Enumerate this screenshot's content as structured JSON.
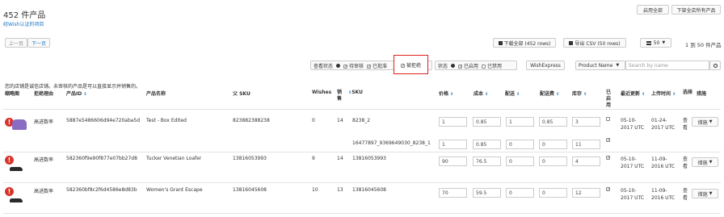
{
  "header": {
    "title": "452 件产品",
    "subtitle": "经Wish认证的项目",
    "enable_all": "启用全部",
    "delist_all": "下架全店所有产品"
  },
  "pager": {
    "prev": "上一页",
    "next": "下一页",
    "range": "1 到 50 件产品",
    "page_size": "50"
  },
  "downloads": {
    "all": "下载全部 (452 rows)",
    "csv": "导出 CSV (50 rows)"
  },
  "filters": {
    "review_label": "查看状态",
    "pending": "待审核",
    "approved": "已批准",
    "rejected": "被拒绝",
    "state_label": "状态",
    "enabled": "已启用",
    "disabled": "已禁用",
    "wishexpress": "WishExpress",
    "search_field": "Product Name",
    "search_placeholder": "Search by name"
  },
  "notice": "您的店铺是诚信店铺。未审核的产品是可以直接显示并销售的。",
  "columns": {
    "thumb": "缩略图",
    "reason": "拒绝理由",
    "product_id": "产品ID",
    "name": "产品名称",
    "parent_sku": "父 SKU",
    "wishes": "Wishes",
    "sales": "销售",
    "sku": "SKU",
    "price": "价格",
    "cost": "成本",
    "shipping": "配送",
    "shipping_fee": "配送费",
    "inventory": "库存",
    "enabled": "已启用",
    "updated": "最近更新",
    "upload_time": "上传时间",
    "select": "选择",
    "actions": "措施"
  },
  "rows": [
    {
      "reason": "高进数率",
      "product_id": "5887e5486606d94e720aba5d",
      "name": "Test - Box Edited",
      "parent_sku": "823882388238",
      "wishes": "0",
      "sales": "14",
      "updated": "05-10-2017 UTC",
      "upload": "01-24-2017 UTC",
      "view": "查看",
      "action": "措施",
      "variants": [
        {
          "sku": "8238_2",
          "price": "1",
          "cost": "0.85",
          "ship": "1",
          "fee": "0.85",
          "inv": "3",
          "enabled": false
        },
        {
          "sku": "16477897_9369649030_8238_1",
          "price": "1",
          "cost": "0.85",
          "ship": "0",
          "fee": "0",
          "inv": "11",
          "enabled": true
        }
      ]
    },
    {
      "reason": "高进数率",
      "product_id": "582360f9e90f877e07bb27d8",
      "name": "Tucker Venetian Loafer",
      "parent_sku": "13816053993",
      "wishes": "9",
      "sales": "14",
      "updated": "05-10-2017 UTC",
      "upload": "11-09-2016 UTC",
      "view": "查看",
      "action": "措施",
      "variants": [
        {
          "sku": "13816053993",
          "price": "90",
          "cost": "76.5",
          "ship": "0",
          "fee": "0",
          "inv": "4",
          "enabled": true
        }
      ]
    },
    {
      "reason": "高进数率",
      "product_id": "582360bf8c2f6d4586e8d83b",
      "name": "Women's Grant Escape",
      "parent_sku": "13816045608",
      "wishes": "10",
      "sales": "13",
      "updated": "05-10-2017 UTC",
      "upload": "11-09-2016 UTC",
      "view": "查看",
      "action": "措施",
      "variants": [
        {
          "sku": "13816045608",
          "price": "70",
          "cost": "59.5",
          "ship": "0",
          "fee": "0",
          "inv": "12",
          "enabled": true
        }
      ]
    }
  ],
  "colors": {
    "link": "#1a77c9",
    "warn": "#d9342b",
    "highlight": "#e02020"
  }
}
